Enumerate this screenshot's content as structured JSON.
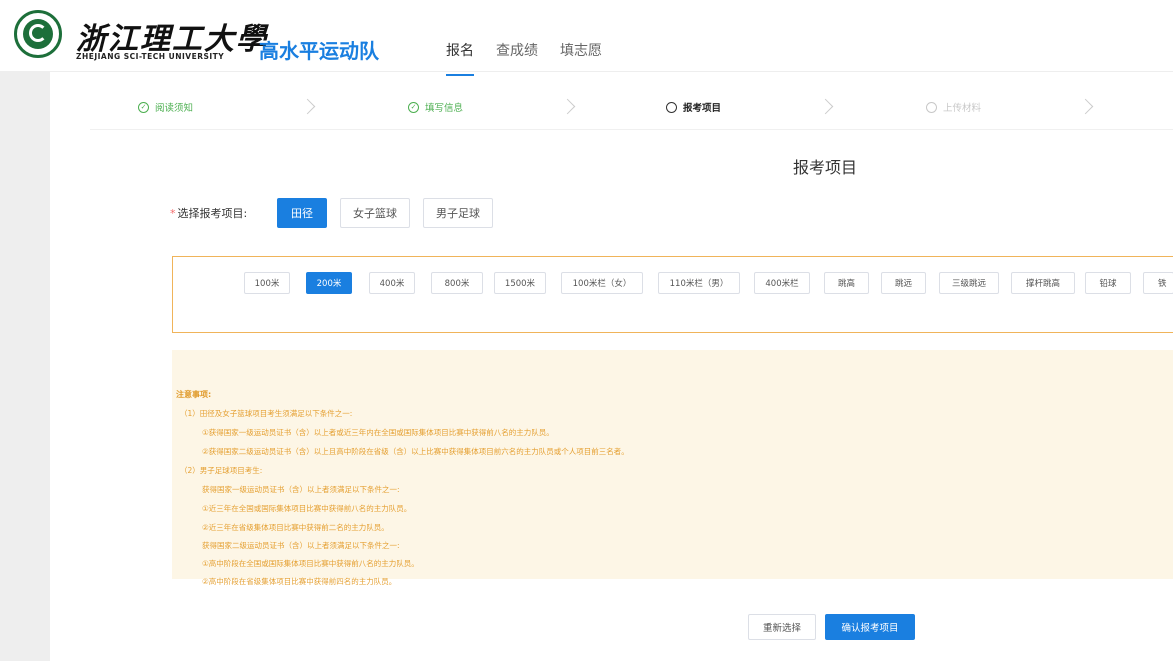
{
  "header": {
    "school_name_cn": "浙江理工大學",
    "school_name_en": "ZHEJIANG SCI-TECH UNIVERSITY",
    "app_title": "高水平运动队",
    "nav_tabs": [
      {
        "label": "报名",
        "active": true
      },
      {
        "label": "查成绩",
        "active": false
      },
      {
        "label": "填志愿",
        "active": false
      }
    ]
  },
  "steps": [
    {
      "label": "阅读须知",
      "status": "done",
      "icon": "✓"
    },
    {
      "label": "填写信息",
      "status": "done",
      "icon": "✓"
    },
    {
      "label": "报考项目",
      "status": "current",
      "icon": ""
    },
    {
      "label": "上传材料",
      "status": "todo",
      "icon": ""
    }
  ],
  "section_title": "报考项目",
  "project_select": {
    "required_mark": "*",
    "label": "选择报考项目:",
    "options": [
      {
        "label": "田径",
        "selected": true
      },
      {
        "label": "女子篮球",
        "selected": false
      },
      {
        "label": "男子足球",
        "selected": false
      }
    ]
  },
  "events": [
    {
      "label": "100米",
      "selected": false
    },
    {
      "label": "200米",
      "selected": true
    },
    {
      "label": "400米",
      "selected": false
    },
    {
      "label": "800米",
      "selected": false
    },
    {
      "label": "1500米",
      "selected": false
    },
    {
      "label": "100米栏（女）",
      "selected": false
    },
    {
      "label": "110米栏（男）",
      "selected": false
    },
    {
      "label": "400米栏",
      "selected": false
    },
    {
      "label": "跳高",
      "selected": false
    },
    {
      "label": "跳远",
      "selected": false
    },
    {
      "label": "三级跳远",
      "selected": false
    },
    {
      "label": "撑杆跳高",
      "selected": false
    },
    {
      "label": "铅球",
      "selected": false
    },
    {
      "label": "铁",
      "selected": false
    }
  ],
  "notice": {
    "heading": "注意事项:",
    "lines": [
      "（1）田径及女子篮球项目考生须满足以下条件之一:",
      "①获得国家一级运动员证书（含）以上者或近三年内在全国或国际集体项目比赛中获得前八名的主力队员。",
      "②获得国家二级运动员证书（含）以上且高中阶段在省级（含）以上比赛中获得集体项目前六名的主力队员或个人项目前三名者。",
      "（2）男子足球项目考生:",
      "获得国家一级运动员证书（含）以上者须满足以下条件之一:",
      "①近三年在全国或国际集体项目比赛中获得前八名的主力队员。",
      "②近三年在省级集体项目比赛中获得前二名的主力队员。",
      "获得国家二级运动员证书（含）以上者须满足以下条件之一:",
      "①高中阶段在全国或国际集体项目比赛中获得前八名的主力队员。",
      "②高中阶段在省级集体项目比赛中获得前四名的主力队员。"
    ]
  },
  "actions": {
    "reset_label": "重新选择",
    "confirm_label": "确认报考项目"
  },
  "colors": {
    "accent": "#1a7fe0",
    "done": "#4caf50",
    "notice_bg": "#fdf6e6",
    "notice_text": "#e5a032",
    "event_border": "#f0b45a"
  }
}
